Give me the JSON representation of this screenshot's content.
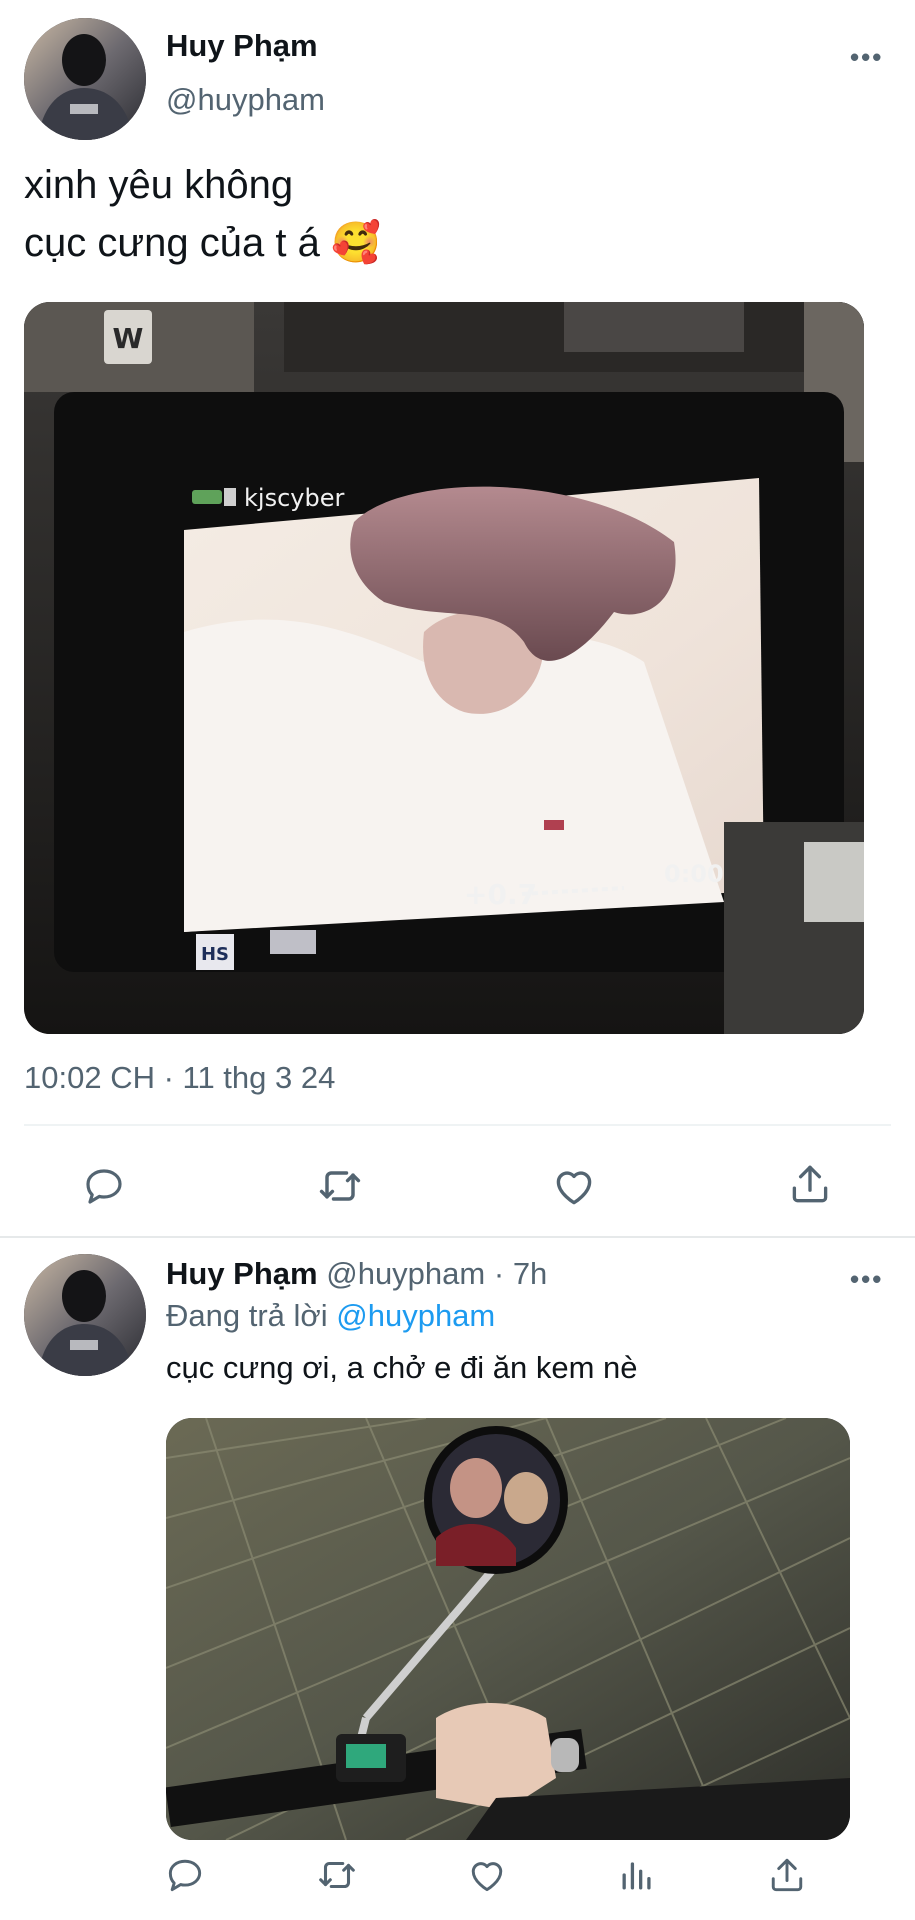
{
  "main_tweet": {
    "display_name": "Huy Phạm",
    "handle": "@huypham",
    "text_line1": "xinh yêu không",
    "text_line2": "cục cưng của t á",
    "emoji": "🥰",
    "media_overlay": {
      "camera_name": "kjscyber",
      "exposure": "+0.7",
      "timecode": "0:00:55",
      "badge": "HS"
    },
    "timestamp": "10:02 CH · 11 thg 3 24",
    "actions": [
      "reply-icon",
      "retweet-icon",
      "like-icon",
      "share-icon"
    ]
  },
  "reply_tweet": {
    "display_name": "Huy Phạm",
    "handle": "@huypham",
    "separator": "·",
    "time": "7h",
    "replying_prefix": "Đang trả lời",
    "replying_to": "@huypham",
    "text": "cục cưng ơi, a chở e đi ăn kem nè",
    "actions": [
      "reply-icon",
      "retweet-icon",
      "like-icon",
      "analytics-icon",
      "share-icon"
    ]
  },
  "colors": {
    "accent": "#1d9bf0",
    "muted": "#536471",
    "divider": "#eff3f4"
  }
}
